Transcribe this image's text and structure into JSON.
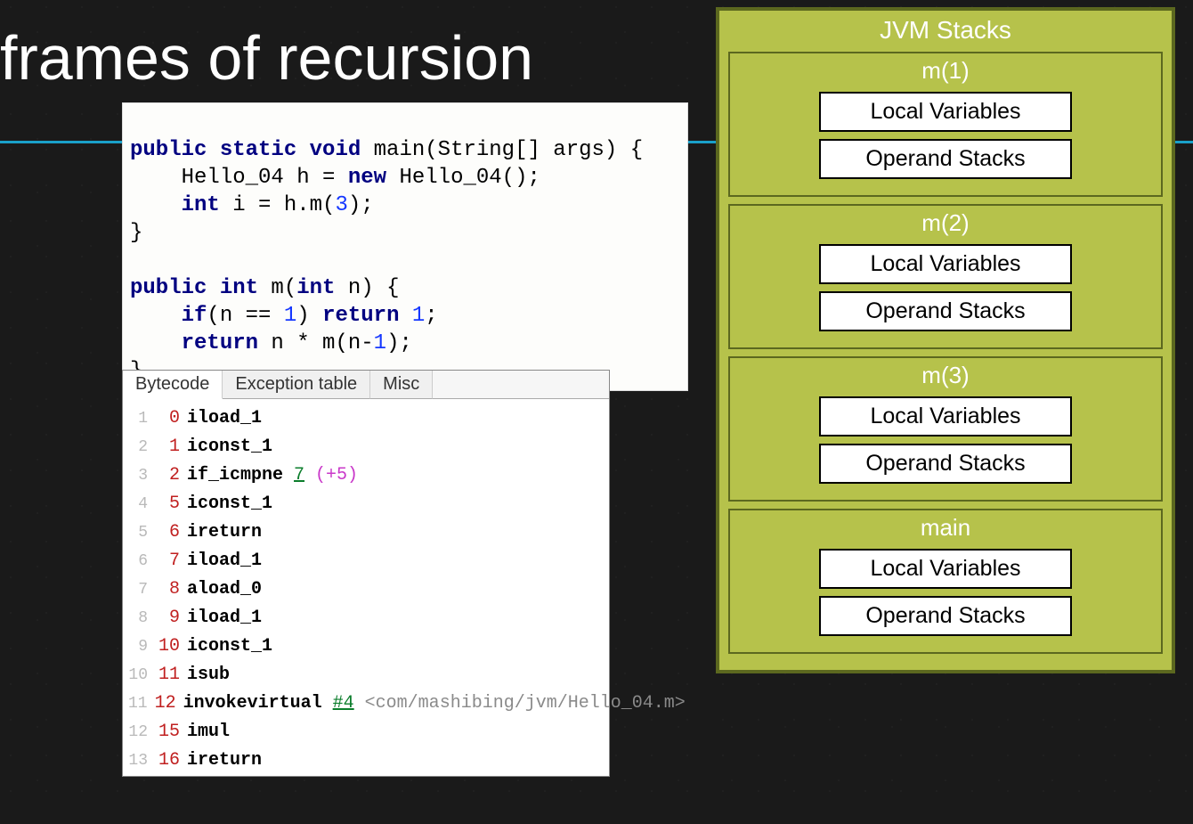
{
  "title": "frames of recursion",
  "code": {
    "main_sig_pre": "public static void",
    "main_sig_post": " main(String[] args) {",
    "line2a": "    Hello_04 h = ",
    "line2b_kw": "new",
    "line2b_post": " Hello_04();",
    "line3_kw": "    int",
    "line3_mid": " i = h.m(",
    "line3_num": "3",
    "line3_end": ");",
    "line4": "}",
    "blank": "",
    "m_sig_kw1": "public",
    "m_sig_kw2": " int",
    "m_sig_mid": " m(",
    "m_sig_kw3": "int",
    "m_sig_end": " n) {",
    "if_kw": "    if",
    "if_mid": "(n == ",
    "if_num1": "1",
    "if_mid2": ") ",
    "ret_kw": "return",
    "if_sp": " ",
    "if_num2": "1",
    "if_semi": ";",
    "ret2_kw": "    return",
    "ret2_mid": " n * m(n-",
    "ret2_num": "1",
    "ret2_end": ");",
    "close": "}"
  },
  "tabs": {
    "t1": "Bytecode",
    "t2": "Exception table",
    "t3": "Misc"
  },
  "bytecode": [
    {
      "ln": "1",
      "off": "0",
      "op": "iload_1",
      "ref": "",
      "note": "",
      "comment": ""
    },
    {
      "ln": "2",
      "off": "1",
      "op": "iconst_1",
      "ref": "",
      "note": "",
      "comment": ""
    },
    {
      "ln": "3",
      "off": "2",
      "op": "if_icmpne ",
      "ref": "7",
      "note": " (+5)",
      "comment": ""
    },
    {
      "ln": "4",
      "off": "5",
      "op": "iconst_1",
      "ref": "",
      "note": "",
      "comment": ""
    },
    {
      "ln": "5",
      "off": "6",
      "op": "ireturn",
      "ref": "",
      "note": "",
      "comment": ""
    },
    {
      "ln": "6",
      "off": "7",
      "op": "iload_1",
      "ref": "",
      "note": "",
      "comment": ""
    },
    {
      "ln": "7",
      "off": "8",
      "op": "aload_0",
      "ref": "",
      "note": "",
      "comment": ""
    },
    {
      "ln": "8",
      "off": "9",
      "op": "iload_1",
      "ref": "",
      "note": "",
      "comment": ""
    },
    {
      "ln": "9",
      "off": "10",
      "op": "iconst_1",
      "ref": "",
      "note": "",
      "comment": ""
    },
    {
      "ln": "10",
      "off": "11",
      "op": "isub",
      "ref": "",
      "note": "",
      "comment": ""
    },
    {
      "ln": "11",
      "off": "12",
      "op": "invokevirtual ",
      "ref": "#4",
      "note": "",
      "comment": " <com/mashibing/jvm/Hello_04.m>"
    },
    {
      "ln": "12",
      "off": "15",
      "op": "imul",
      "ref": "",
      "note": "",
      "comment": ""
    },
    {
      "ln": "13",
      "off": "16",
      "op": "ireturn",
      "ref": "",
      "note": "",
      "comment": ""
    }
  ],
  "stacks": {
    "title": "JVM Stacks",
    "local": "Local Variables",
    "operand": "Operand Stacks",
    "frames": [
      {
        "name": "m(1)"
      },
      {
        "name": "m(2)"
      },
      {
        "name": "m(3)"
      },
      {
        "name": "main"
      }
    ]
  }
}
